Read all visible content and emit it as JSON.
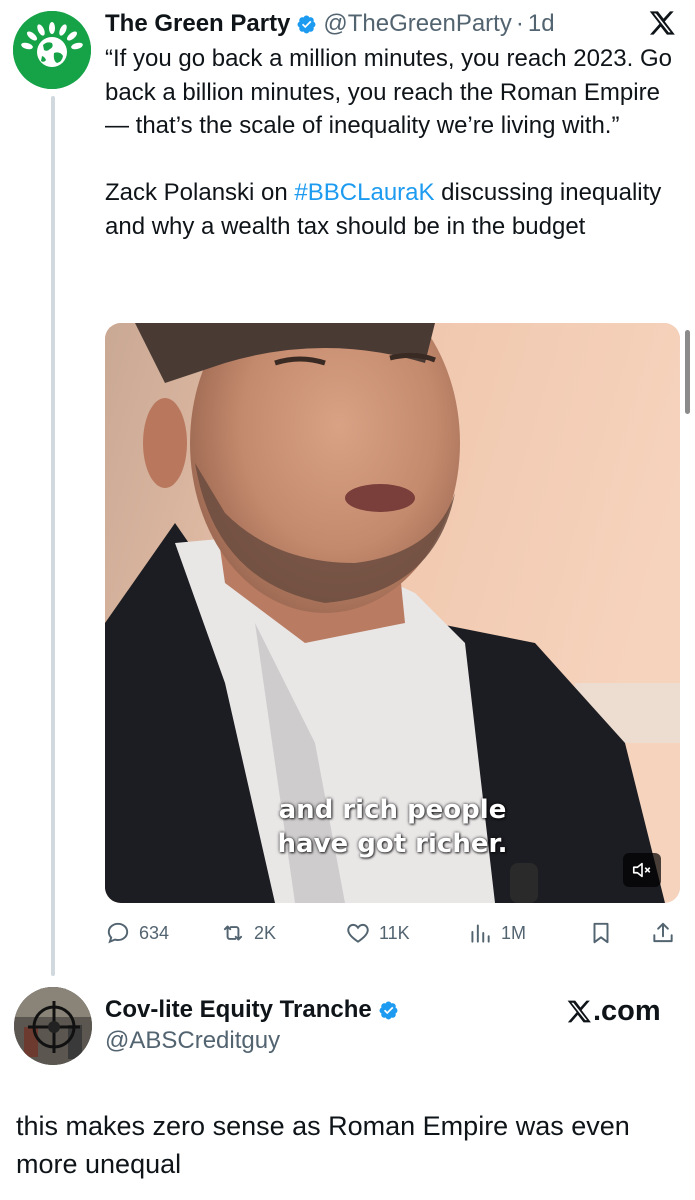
{
  "tweet": {
    "author": {
      "display_name": "The Green Party",
      "handle": "@TheGreenParty",
      "separator": "·",
      "time": "1d",
      "avatar_icon": "earth-leaves-icon",
      "brand_color": "#16a348"
    },
    "text": {
      "line1": "“If you go back a million minutes, you reach 2023. Go back a billion minutes, you reach the Roman Empire — that’s the scale of inequality we’re living with.”",
      "line2_before": "Zack Polanski on ",
      "hashtag": "#BBCLauraK",
      "line2_after": " discussing inequality and why a wealth tax should be in the budget"
    },
    "media": {
      "caption_line1": "and rich people",
      "caption_line2": "have got richer."
    },
    "actions": {
      "replies": "634",
      "reposts": "2K",
      "likes": "11K",
      "views": "1M"
    },
    "link_color": "#1d9bf0"
  },
  "reply": {
    "display_name": "Cov-lite Equity Tranche",
    "handle": "@ABSCreditguy",
    "text": "this makes zero sense as Roman Empire was even more unequal"
  },
  "watermark": {
    "label": ".com"
  },
  "colors": {
    "verified": "#1d9bf0",
    "muted_text": "#536471",
    "primary_text": "#0f1419"
  }
}
